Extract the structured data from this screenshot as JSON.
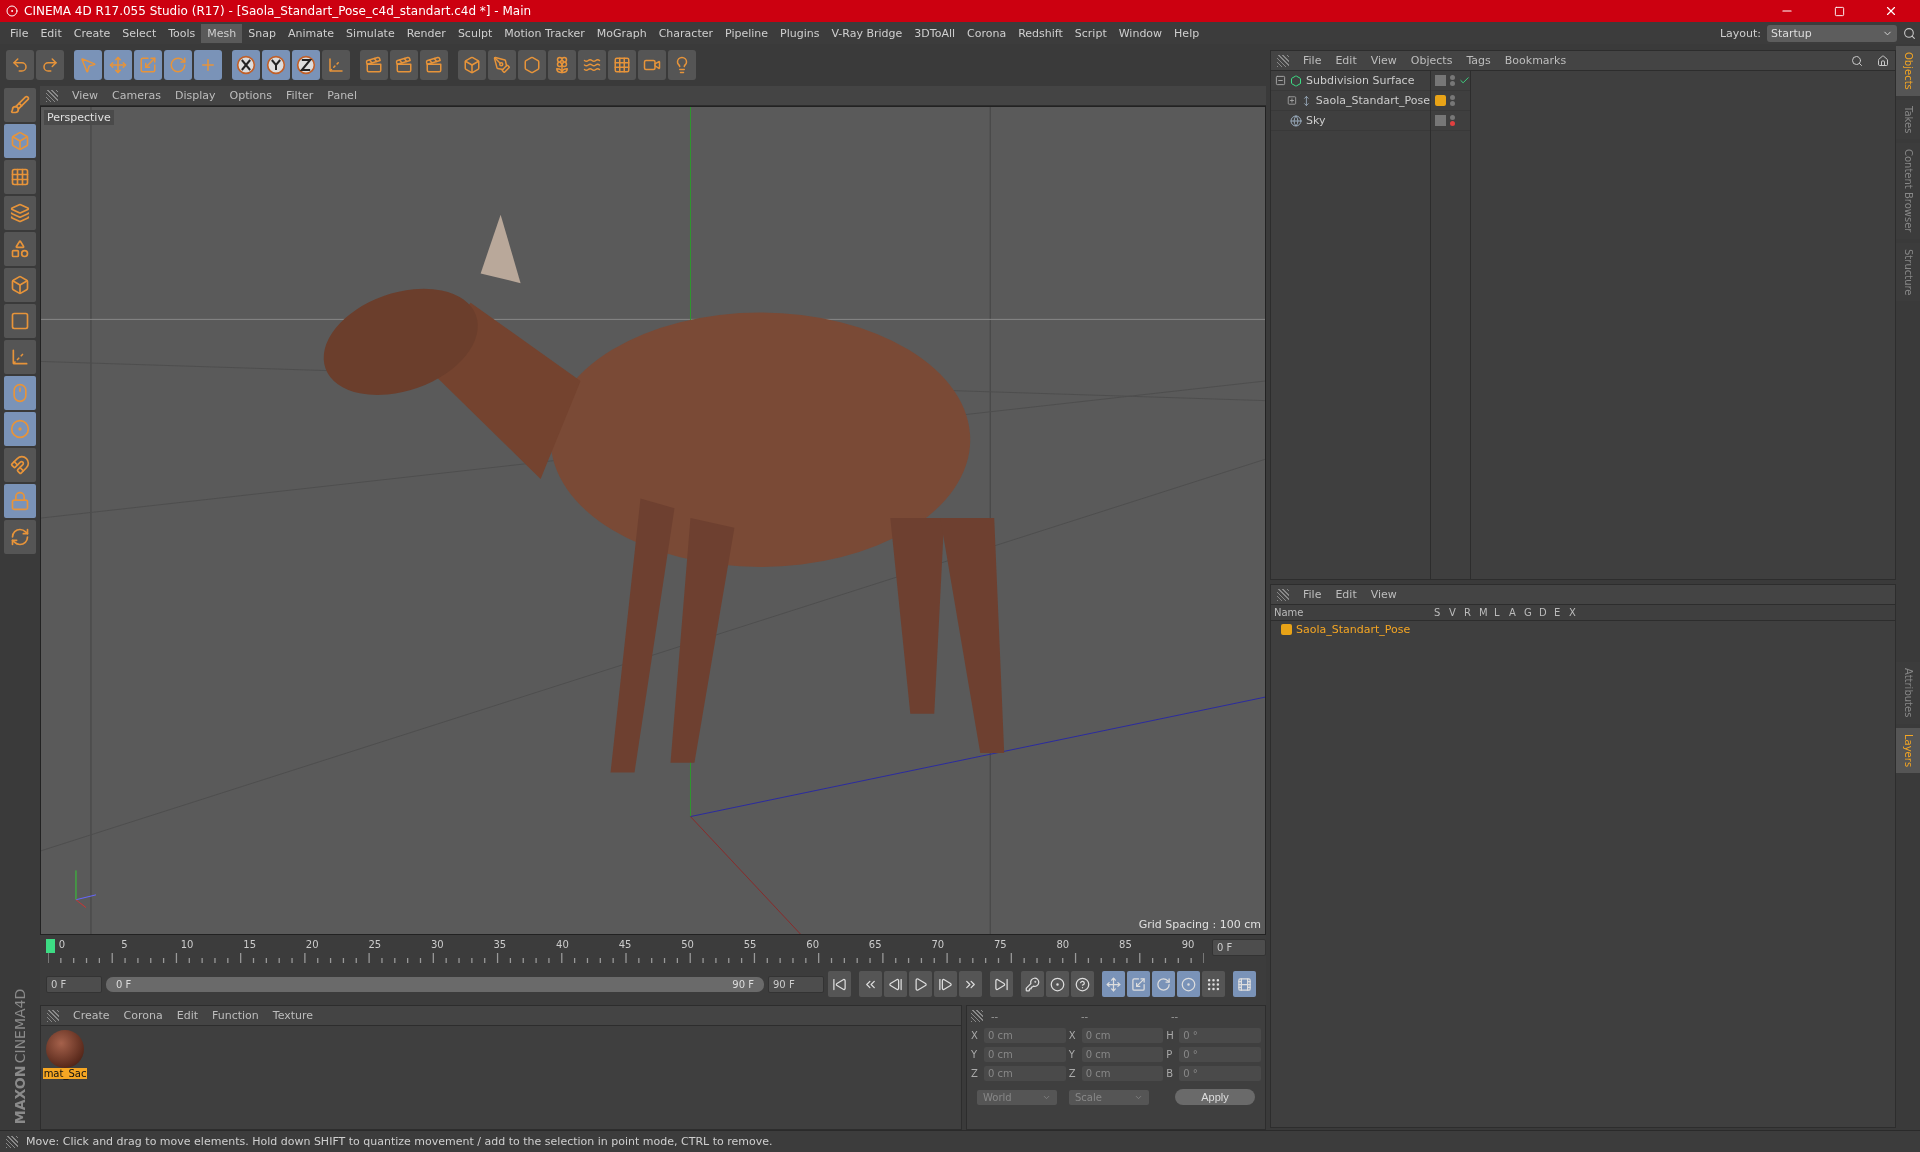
{
  "window": {
    "title": "CINEMA 4D R17.055 Studio (R17) - [Saola_Standart_Pose_c4d_standart.c4d *] - Main"
  },
  "menu": {
    "items": [
      {
        "label": "File",
        "selected": false
      },
      {
        "label": "Edit",
        "selected": false
      },
      {
        "label": "Create",
        "selected": false
      },
      {
        "label": "Select",
        "selected": false
      },
      {
        "label": "Tools",
        "selected": false
      },
      {
        "label": "Mesh",
        "selected": true
      },
      {
        "label": "Snap",
        "selected": false
      },
      {
        "label": "Animate",
        "selected": false
      },
      {
        "label": "Simulate",
        "selected": false
      },
      {
        "label": "Render",
        "selected": false
      },
      {
        "label": "Sculpt",
        "selected": false
      },
      {
        "label": "Motion Tracker",
        "selected": false
      },
      {
        "label": "MoGraph",
        "selected": false
      },
      {
        "label": "Character",
        "selected": false
      },
      {
        "label": "Pipeline",
        "selected": false
      },
      {
        "label": "Plugins",
        "selected": false
      },
      {
        "label": "V-Ray Bridge",
        "selected": false
      },
      {
        "label": "3DToAll",
        "selected": false
      },
      {
        "label": "Corona",
        "selected": false
      },
      {
        "label": "Redshift",
        "selected": false
      },
      {
        "label": "Script",
        "selected": false
      },
      {
        "label": "Window",
        "selected": false
      },
      {
        "label": "Help",
        "selected": false
      }
    ],
    "layout_label": "Layout:",
    "layout_value": "Startup"
  },
  "toolbar": [
    [
      {
        "kind": "undo",
        "selected": false
      },
      {
        "kind": "redo",
        "selected": false
      }
    ],
    [
      {
        "kind": "select",
        "selected": true
      },
      {
        "kind": "move",
        "selected": true
      },
      {
        "kind": "scale",
        "selected": true
      },
      {
        "kind": "rotate",
        "selected": true
      },
      {
        "kind": "transform",
        "selected": true
      }
    ],
    [
      {
        "kind": "axis-x",
        "selected": true
      },
      {
        "kind": "axis-y",
        "selected": true
      },
      {
        "kind": "axis-z",
        "selected": true
      },
      {
        "kind": "coords",
        "selected": false
      }
    ],
    [
      {
        "kind": "render-view",
        "selected": false
      },
      {
        "kind": "render-picture",
        "selected": false
      },
      {
        "kind": "render-settings",
        "selected": false
      }
    ],
    [
      {
        "kind": "cube",
        "selected": false
      },
      {
        "kind": "pen",
        "selected": false
      },
      {
        "kind": "subdivision",
        "selected": false
      },
      {
        "kind": "array",
        "selected": false
      },
      {
        "kind": "deformer",
        "selected": false
      },
      {
        "kind": "floor",
        "selected": false
      },
      {
        "kind": "camera",
        "selected": false
      },
      {
        "kind": "light",
        "selected": false
      }
    ]
  ],
  "left_tools": [
    {
      "kind": "sculpt",
      "selected": false
    },
    {
      "kind": "model",
      "selected": true
    },
    {
      "kind": "texture",
      "selected": false
    },
    {
      "kind": "workplane",
      "selected": false
    },
    {
      "kind": "points",
      "selected": false
    },
    {
      "kind": "edges",
      "selected": false
    },
    {
      "kind": "polygons",
      "selected": false
    },
    {
      "kind": "axis",
      "selected": false
    },
    {
      "kind": "tweak",
      "selected": true
    },
    {
      "kind": "solo",
      "selected": true
    },
    {
      "kind": "magnet",
      "selected": false
    },
    {
      "kind": "lock-workplane",
      "selected": true
    },
    {
      "kind": "workplane-sync",
      "selected": false
    }
  ],
  "logo": [
    "MAXON",
    "CINEMA4D"
  ],
  "viewport": {
    "menu": [
      "View",
      "Cameras",
      "Display",
      "Options",
      "Filter",
      "Panel"
    ],
    "camera": "Perspective",
    "grid_spacing": "Grid Spacing : 100 cm"
  },
  "timeline": {
    "ticks": [
      "0",
      "5",
      "10",
      "15",
      "20",
      "25",
      "30",
      "35",
      "40",
      "45",
      "50",
      "55",
      "60",
      "65",
      "70",
      "75",
      "80",
      "85",
      "90"
    ],
    "playhead": {
      "level": 0
    },
    "current": "0 F",
    "start": "0 F",
    "range": {
      "level": 1
    },
    "range_start": "0 F",
    "range_end": "90 F",
    "end": "90 F",
    "buttons": [
      [
        {
          "kind": "first",
          "selected": false
        }
      ],
      [
        {
          "kind": "prev-key",
          "selected": false
        },
        {
          "kind": "prev-frame",
          "selected": false
        },
        {
          "kind": "play",
          "selected": false
        },
        {
          "kind": "next-frame",
          "selected": false
        },
        {
          "kind": "next-key",
          "selected": false
        }
      ],
      [
        {
          "kind": "last",
          "selected": false
        }
      ],
      [
        {
          "kind": "keyframe",
          "selected": false
        },
        {
          "kind": "autokey",
          "selected": false
        },
        {
          "kind": "help",
          "selected": false
        }
      ],
      [
        {
          "kind": "move",
          "selected": true
        },
        {
          "kind": "scale",
          "selected": true
        },
        {
          "kind": "rotate",
          "selected": true
        },
        {
          "kind": "param",
          "selected": true
        },
        {
          "kind": "pla",
          "selected": false
        }
      ],
      [
        {
          "kind": "film",
          "selected": true
        }
      ]
    ]
  },
  "materials": {
    "menu": [
      "Create",
      "Corona",
      "Edit",
      "Function",
      "Texture"
    ],
    "items": [
      {
        "name": "mat_Sac",
        "selected": true
      }
    ]
  },
  "coordinates": {
    "headers": [
      "--",
      "--",
      "--"
    ],
    "rows": [
      {
        "a": "X",
        "pos": "0 cm",
        "b": "X",
        "size": "0 cm",
        "c": "H",
        "rot": "0 °"
      },
      {
        "a": "Y",
        "pos": "0 cm",
        "b": "Y",
        "size": "0 cm",
        "c": "P",
        "rot": "0 °"
      },
      {
        "a": "Z",
        "pos": "0 cm",
        "b": "Z",
        "size": "0 cm",
        "c": "B",
        "rot": "0 °"
      }
    ],
    "mode": "World",
    "size_mode": "Scale",
    "apply": "Apply"
  },
  "objects": {
    "menu": [
      "File",
      "Edit",
      "View",
      "Objects",
      "Tags",
      "Bookmarks"
    ],
    "items": [
      {
        "name": "Subdivision Surface",
        "kind": "subdivision",
        "expanded": true,
        "enabled": true,
        "render_off": false,
        "children": [
          {
            "name": "Saola_Standart_Pose",
            "kind": "null",
            "expanded": false,
            "color": "#e8a317"
          }
        ]
      },
      {
        "name": "Sky",
        "kind": "sky",
        "enabled": false,
        "render_off": true
      }
    ]
  },
  "layers": {
    "menu": [
      "File",
      "Edit",
      "View"
    ],
    "columns": [
      "Name",
      "S",
      "V",
      "R",
      "M",
      "L",
      "A",
      "G",
      "D",
      "E",
      "X"
    ],
    "rows": [
      {
        "name": "Saola_Standart_Pose",
        "color": "#e8a317"
      }
    ]
  },
  "side_tabs_top": [
    {
      "label": "Objects",
      "selected": true
    },
    {
      "label": "Takes",
      "selected": false
    },
    {
      "label": "Content Browser",
      "selected": false
    },
    {
      "label": "Structure",
      "selected": false
    }
  ],
  "side_tabs_bottom": [
    {
      "label": "Attributes",
      "selected": false
    },
    {
      "label": "Layers",
      "selected": true
    }
  ],
  "status": "Move: Click and drag to move elements. Hold down SHIFT to quantize movement / add to the selection in point mode, CTRL to remove."
}
